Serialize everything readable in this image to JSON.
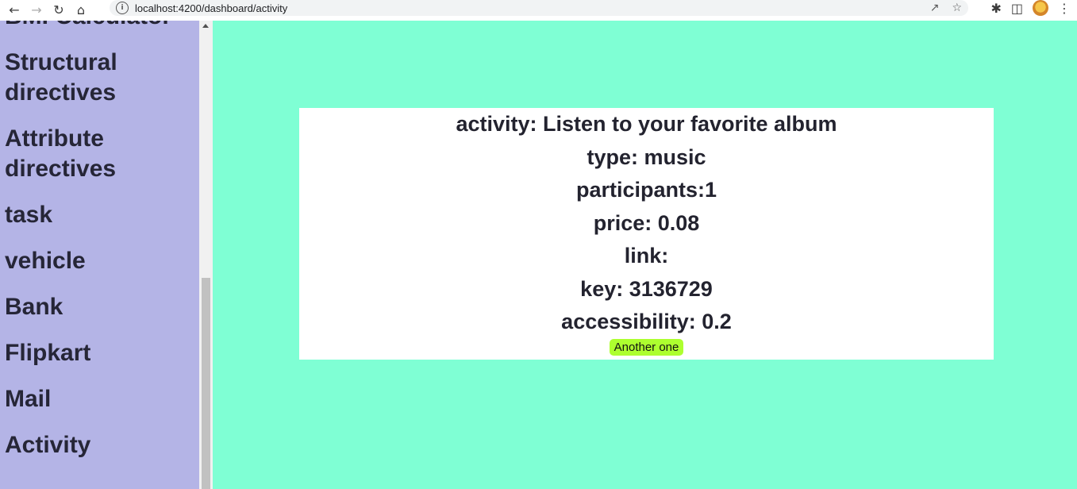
{
  "browser": {
    "url": "localhost:4200/dashboard/activity"
  },
  "sidebar": {
    "items": [
      {
        "label": "BMI Calculator"
      },
      {
        "label": "Structural directives"
      },
      {
        "label": "Attribute directives"
      },
      {
        "label": "task"
      },
      {
        "label": "vehicle"
      },
      {
        "label": "Bank"
      },
      {
        "label": "Flipkart"
      },
      {
        "label": "Mail"
      },
      {
        "label": "Activity"
      }
    ]
  },
  "activity": {
    "activity_line": "activity: Listen to your favorite album",
    "type_line": "type: music",
    "participants_line": "participants:1",
    "price_line": "price: 0.08",
    "link_line": "link:",
    "key_line": "key: 3136729",
    "accessibility_line": "accessibility: 0.2",
    "button_label": "Another one"
  },
  "colors": {
    "sidebar_bg": "#b4b4e6",
    "main_bg": "#7fffd4",
    "button_bg": "#adff2f"
  }
}
